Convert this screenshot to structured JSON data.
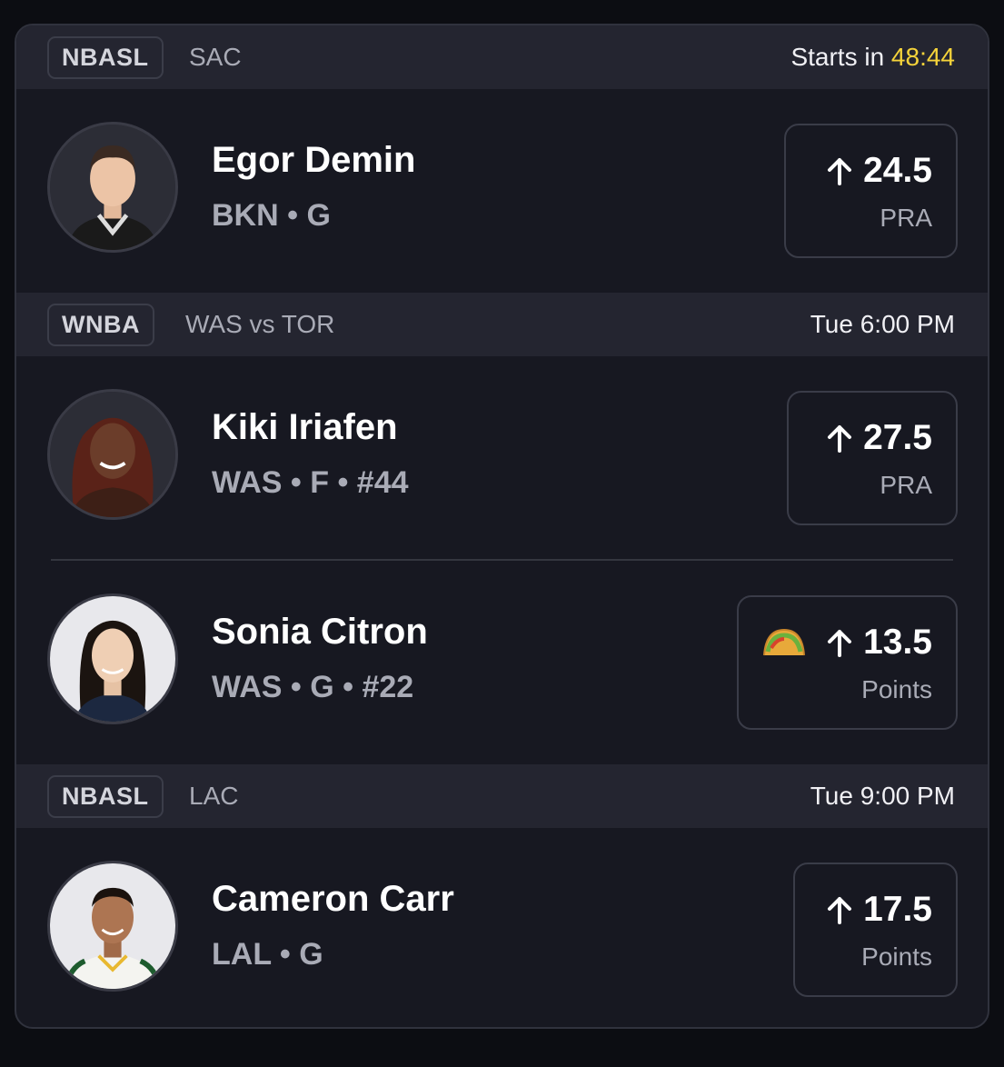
{
  "games": [
    {
      "league": "NBASL",
      "matchup": "SAC",
      "time_prefix": "Starts in ",
      "countdown": "48:44",
      "players": [
        {
          "name": "Egor Demin",
          "meta": "BKN • G",
          "line": "24.5",
          "stat": "PRA",
          "direction_icon": "arrow-up-icon"
        }
      ]
    },
    {
      "league": "WNBA",
      "matchup": "WAS vs TOR",
      "time": "Tue 6:00 PM",
      "players": [
        {
          "name": "Kiki Iriafen",
          "meta": "WAS • F • #44",
          "line": "27.5",
          "stat": "PRA",
          "direction_icon": "arrow-up-icon"
        },
        {
          "name": "Sonia Citron",
          "meta": "WAS • G • #22",
          "line": "13.5",
          "stat": "Points",
          "direction_icon": "arrow-up-icon",
          "promo_icon": "taco-icon"
        }
      ]
    },
    {
      "league": "NBASL",
      "matchup": "LAC",
      "time": "Tue 9:00 PM",
      "players": [
        {
          "name": "Cameron Carr",
          "meta": "LAL • G",
          "line": "17.5",
          "stat": "Points",
          "direction_icon": "arrow-up-icon"
        }
      ]
    }
  ],
  "colors": {
    "accent_countdown": "#f5d33a",
    "card_bg": "#171821",
    "header_bg": "#242530"
  }
}
